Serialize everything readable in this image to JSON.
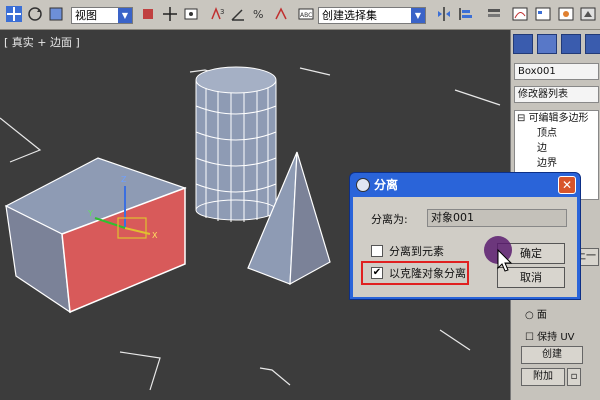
{
  "toolbar": {
    "view_dropdown": "视图",
    "selection_set_dropdown": "创建选择集"
  },
  "viewport": {
    "label": "[ 真实 + 边面 ]"
  },
  "panel": {
    "object_name": "Box001",
    "modifier_list": "修改器列表",
    "stack": [
      "可编辑多边形",
      "顶点",
      "边",
      "边界"
    ],
    "preserve_uv": "保持 UV",
    "face_label": "面",
    "create_button": "创建",
    "attach_button": "附加",
    "prev_label": "上一"
  },
  "dialog": {
    "title": "分离",
    "detach_as_label": "分离为:",
    "object_name_value": "对象001",
    "detach_to_element": "分离到元素",
    "detach_as_clone": "以克隆对象分离",
    "ok_button": "确定",
    "cancel_button": "取消",
    "close_glyph": "✕"
  },
  "colors": {
    "box_top": "#8e9bb4",
    "box_front_selected": "#d85a5a",
    "dialog_titlebar": "#2a64d9",
    "highlight": "#e02020"
  }
}
